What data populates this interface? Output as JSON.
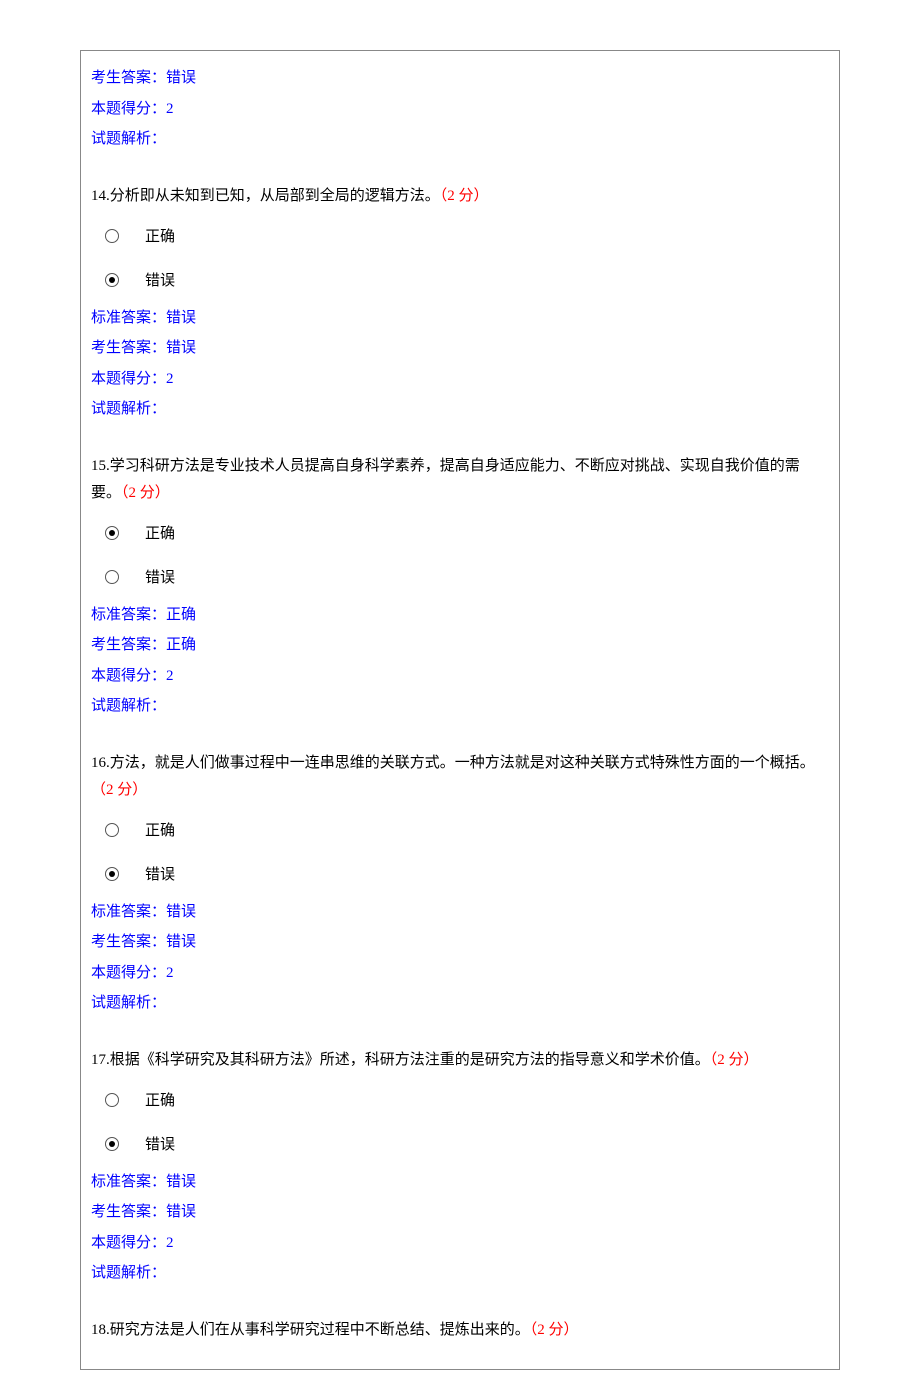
{
  "labels": {
    "student_answer": "考生答案：",
    "standard_answer": "标准答案：",
    "score": "本题得分：",
    "analysis": "试题解析：",
    "correct": "正确",
    "incorrect": "错误",
    "points_suffix": "（2 分）"
  },
  "preamble": {
    "student_answer": "错误",
    "score": "2",
    "analysis": ""
  },
  "questions": [
    {
      "number": "14.",
      "text": "分析即从未知到已知，从局部到全局的逻辑方法。",
      "selected": "incorrect",
      "standard_answer": "错误",
      "student_answer": "错误",
      "score": "2",
      "analysis": ""
    },
    {
      "number": "15.",
      "text": "学习科研方法是专业技术人员提高自身科学素养，提高自身适应能力、不断应对挑战、实现自我价值的需要。",
      "selected": "correct",
      "standard_answer": "正确",
      "student_answer": "正确",
      "score": "2",
      "analysis": ""
    },
    {
      "number": "16.",
      "text": "方法，就是人们做事过程中一连串思维的关联方式。一种方法就是对这种关联方式特殊性方面的一个概括。",
      "selected": "incorrect",
      "standard_answer": "错误",
      "student_answer": "错误",
      "score": "2",
      "analysis": ""
    },
    {
      "number": "17.",
      "text": "根据《科学研究及其科研方法》所述，科研方法注重的是研究方法的指导意义和学术价值。",
      "selected": "incorrect",
      "standard_answer": "错误",
      "student_answer": "错误",
      "score": "2",
      "analysis": ""
    },
    {
      "number": "18.",
      "text": "研究方法是人们在从事科学研究过程中不断总结、提炼出来的。",
      "selected": null,
      "standard_answer": null,
      "student_answer": null,
      "score": null,
      "analysis": null
    }
  ]
}
